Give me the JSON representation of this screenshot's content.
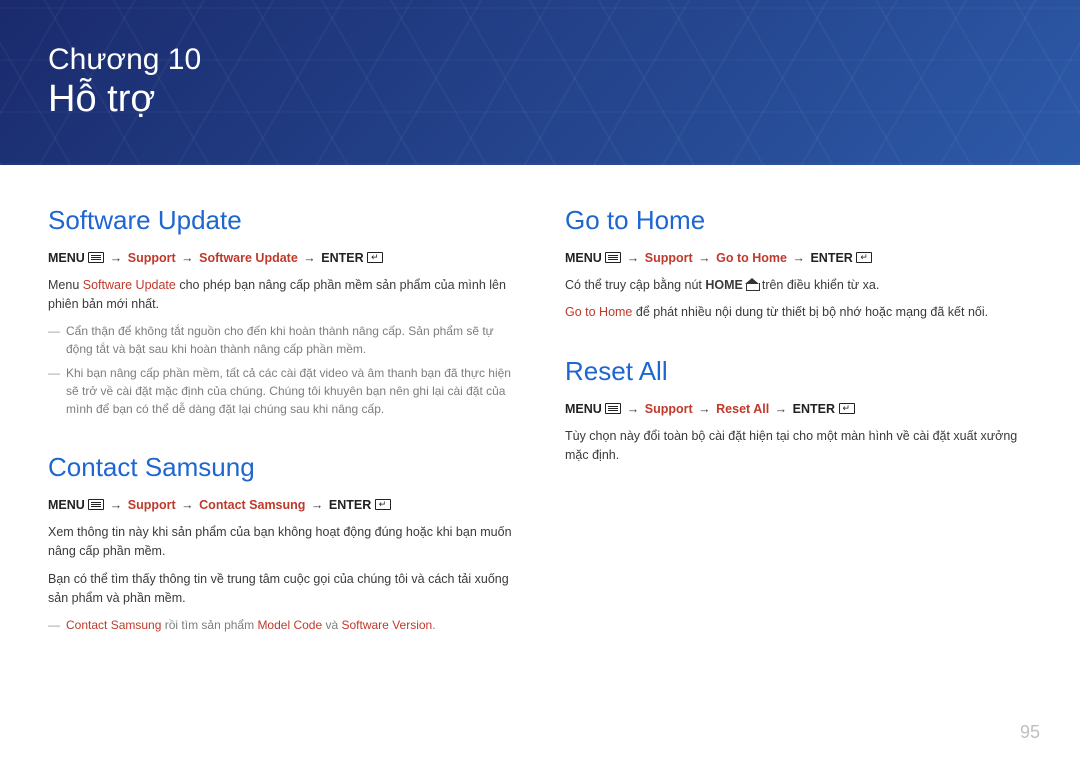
{
  "banner": {
    "chapter_line": "Chương 10",
    "title": "Hỗ trợ"
  },
  "page_number": "95",
  "left": {
    "software_update": {
      "heading": "Software Update",
      "path": {
        "pre": "MENU",
        "support": "Support",
        "item": "Software Update",
        "post": "ENTER"
      },
      "body_pre": "Menu ",
      "body_hl": "Software Update",
      "body_post": " cho phép bạn nâng cấp phần mềm sản phẩm của mình lên phiên bản mới nhất.",
      "notes": [
        "Cẩn thận để không tắt nguồn cho đến khi hoàn thành nâng cấp. Sản phẩm sẽ tự động tắt và bật sau khi hoàn thành nâng cấp phần mềm.",
        "Khi bạn nâng cấp phần mềm, tất cả các cài đặt video và âm thanh bạn đã thực hiện sẽ trở về cài đặt mặc định của chúng. Chúng tôi khuyên bạn nên ghi lại cài đặt của mình để bạn có thể dễ dàng đặt lại chúng sau khi nâng cấp."
      ]
    },
    "contact_samsung": {
      "heading": "Contact Samsung",
      "path": {
        "pre": "MENU",
        "support": "Support",
        "item": "Contact Samsung",
        "post": "ENTER"
      },
      "body1": "Xem thông tin này khi sản phẩm của bạn không hoạt động đúng hoặc khi bạn muốn nâng cấp phần mềm.",
      "body2": "Bạn có thể tìm thấy thông tin về trung tâm cuộc gọi của chúng tôi và cách tải xuống sản phẩm và phần mềm.",
      "note_parts": {
        "p1": "Contact Samsung",
        "p2": " rồi tìm sản phẩm ",
        "p3": "Model Code",
        "p4": " và ",
        "p5": "Software Version",
        "p6": "."
      }
    }
  },
  "right": {
    "go_to_home": {
      "heading": "Go to Home",
      "path": {
        "pre": "MENU",
        "support": "Support",
        "item": "Go to Home",
        "post": "ENTER"
      },
      "body1_pre": "Có thể truy cập bằng nút ",
      "body1_bold": "HOME",
      "body1_post": " trên điều khiển từ xa.",
      "body2_hl": "Go to Home",
      "body2_post": " để phát nhiều nội dung từ thiết bị bộ nhớ hoặc mạng đã kết nối."
    },
    "reset_all": {
      "heading": "Reset All",
      "path": {
        "pre": "MENU",
        "support": "Support",
        "item": "Reset All",
        "post": "ENTER"
      },
      "body": "Tùy chọn này đổi toàn bộ cài đặt hiện tại cho một màn hình về cài đặt xuất xưởng mặc định."
    }
  }
}
